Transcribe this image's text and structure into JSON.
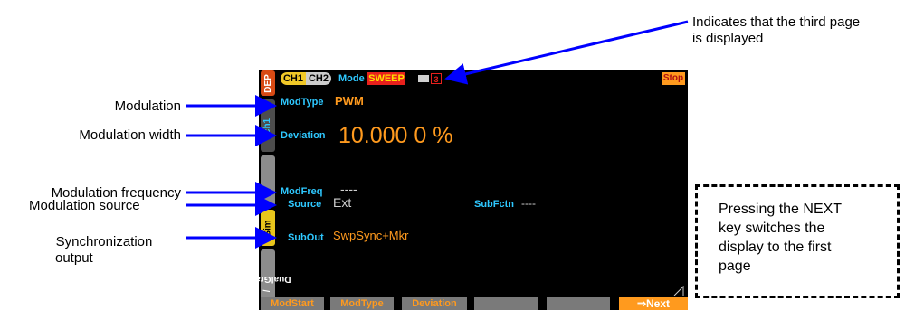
{
  "annotations": {
    "modulation": "Modulation",
    "modulation_width": "Modulation width",
    "modulation_frequency": "Modulation frequency",
    "modulation_source": "Modulation source",
    "sync_line1": "Synchronization",
    "sync_line2": "output",
    "page_note_line1": "Indicates that the third page",
    "page_note_line2": "is displayed",
    "next_note_line1": "Pressing the NEXT",
    "next_note_line2": "key switches the",
    "next_note_line3": "display to the first",
    "next_note_line4": "page"
  },
  "screen": {
    "side_tabs": [
      "DEP",
      "ch1",
      "Sim",
      "Graph",
      "Dual"
    ],
    "header": {
      "ch1": "CH1",
      "ch2": "CH2",
      "mode_label": "Mode",
      "mode_value": "SWEEP",
      "page": "3",
      "status": "Stop"
    },
    "fields": {
      "modtype_label": "ModType",
      "modtype_value": "PWM",
      "deviation_label": "Deviation",
      "deviation_value": "10.000 0 %",
      "modfreq_label": "ModFreq",
      "modfreq_value": "----",
      "source_label": "Source",
      "source_value": "Ext",
      "subfctn_label": "SubFctn",
      "subfctn_value": "----",
      "subout_label": "SubOut",
      "subout_value": "SwpSync+Mkr"
    },
    "softkeys": [
      "ModStart",
      "ModType",
      "Deviation",
      "",
      "",
      "⇒Next"
    ]
  },
  "colors": {
    "accent_orange": "#ff9a1e",
    "field_cyan": "#2ec8ff",
    "arrow_blue": "#0000ff",
    "mode_red": "#e8201c"
  }
}
